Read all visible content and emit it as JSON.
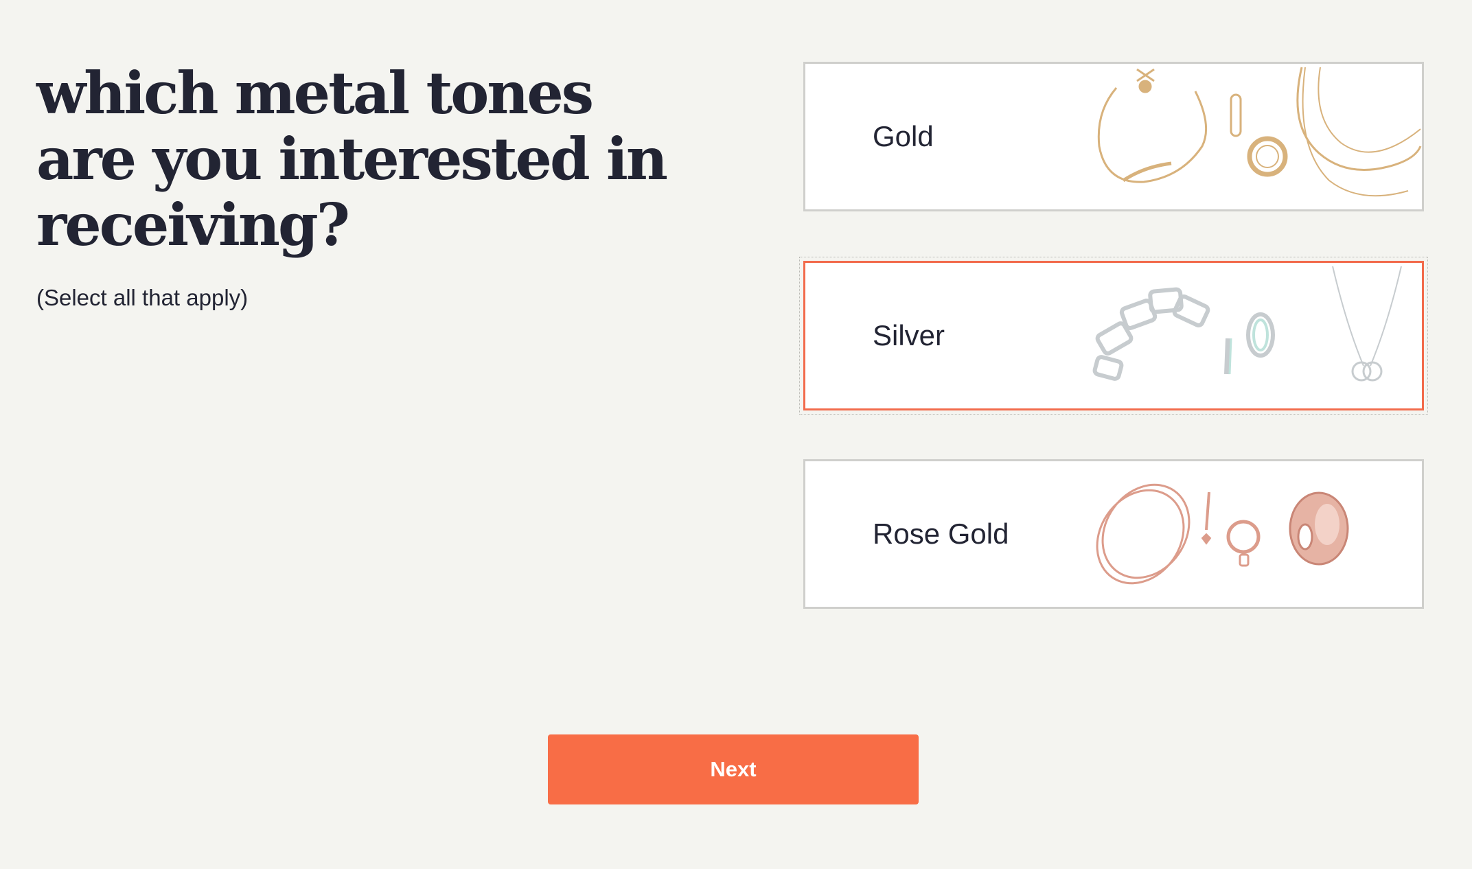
{
  "question": {
    "line1": "which metal tones",
    "line2": "are you interested in",
    "line3": "receiving?",
    "hint": "(Select all that apply)"
  },
  "options": [
    {
      "label": "Gold",
      "selected": false,
      "image_icon": "gold-jewelry-icon",
      "tone_color": "#d8b27c"
    },
    {
      "label": "Silver",
      "selected": true,
      "image_icon": "silver-jewelry-icon",
      "tone_color": "#c7cccf"
    },
    {
      "label": "Rose Gold",
      "selected": false,
      "image_icon": "rose-gold-jewelry-icon",
      "tone_color": "#dc9c8b"
    }
  ],
  "next_button": {
    "label": "Next"
  },
  "colors": {
    "accent": "#f86d46",
    "selected_border": "#f26b4c",
    "card_border": "#cfcfcc",
    "background": "#f4f4f0",
    "text": "#222433"
  }
}
